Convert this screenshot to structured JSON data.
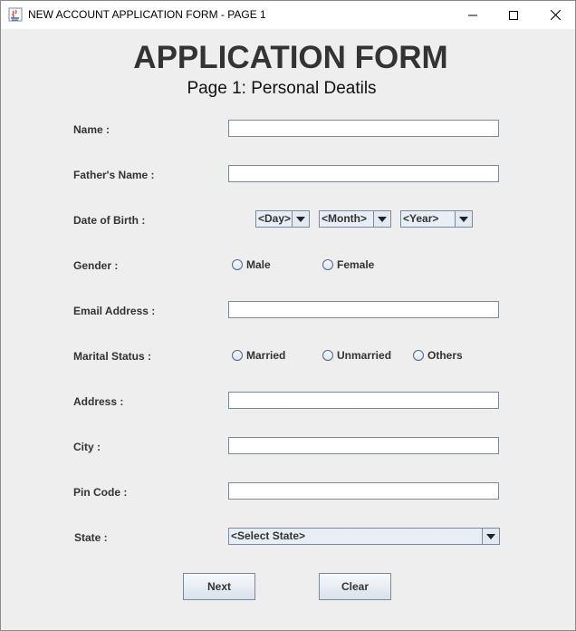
{
  "window": {
    "title": "NEW ACCOUNT APPLICATION FORM - PAGE 1",
    "controls": {
      "minimize": "—",
      "maximize": "☐",
      "close": "✕"
    }
  },
  "form": {
    "title": "APPLICATION FORM",
    "subtitle": "Page 1: Personal Deatils"
  },
  "fields": {
    "name": {
      "label": "Name :",
      "value": ""
    },
    "father_name": {
      "label": "Father's Name :",
      "value": ""
    },
    "dob": {
      "label": "Date of Birth :",
      "day": "<Day>",
      "month": "<Month>",
      "year": "<Year>"
    },
    "gender": {
      "label": "Gender :",
      "options": [
        "Male",
        "Female"
      ]
    },
    "email": {
      "label": "Email Address :",
      "value": ""
    },
    "marital_status": {
      "label": "Marital Status :",
      "options": [
        "Married",
        "Unmarried",
        "Others"
      ]
    },
    "address": {
      "label": "Address :",
      "value": ""
    },
    "city": {
      "label": "City :",
      "value": ""
    },
    "pin_code": {
      "label": "Pin Code :",
      "value": ""
    },
    "state": {
      "label": "State :",
      "selected": "<Select State>"
    }
  },
  "buttons": {
    "next": "Next",
    "clear": "Clear"
  }
}
